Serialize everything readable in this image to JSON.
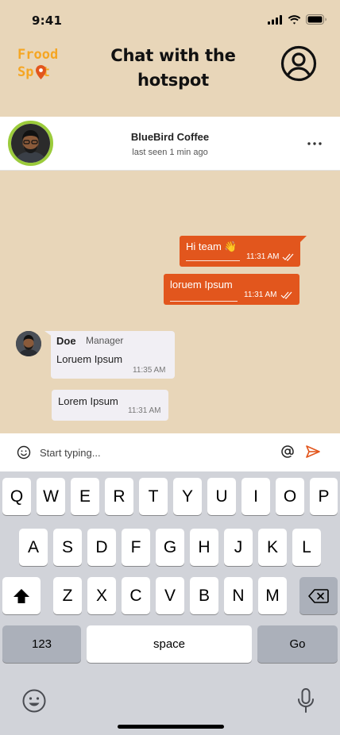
{
  "status_bar": {
    "time": "9:41"
  },
  "header": {
    "logo_line1": "Frood",
    "logo_line2": "Sp t",
    "title": "Chat with the hotspot"
  },
  "contact": {
    "name": "BlueBird Coffee",
    "status": "last seen 1 min ago"
  },
  "messages": [
    {
      "direction": "out",
      "text": "Hi team 👋",
      "time": "11:31 AM",
      "read": true
    },
    {
      "direction": "out",
      "text": "loruem Ipsum",
      "time": "11:31 AM",
      "read": true
    },
    {
      "direction": "in",
      "sender": "Doe",
      "role": "Manager",
      "text": "Loruem Ipsum",
      "time": "11:35 AM"
    },
    {
      "direction": "in",
      "text": "Lorem Ipsum",
      "time": "11:31 AM"
    }
  ],
  "composer": {
    "placeholder": "Start typing..."
  },
  "keyboard": {
    "row1": [
      "Q",
      "W",
      "E",
      "R",
      "T",
      "Y",
      "U",
      "I",
      "O",
      "P"
    ],
    "row2": [
      "A",
      "S",
      "D",
      "F",
      "G",
      "H",
      "J",
      "K",
      "L"
    ],
    "row3": [
      "Z",
      "X",
      "C",
      "V",
      "B",
      "N",
      "M"
    ],
    "numbers_label": "123",
    "space_label": "space",
    "go_label": "Go"
  },
  "colors": {
    "background": "#E8D6B9",
    "accent": "#E2561D",
    "logo": "#F5A623",
    "avatar_ring": "#9BCB3B"
  }
}
